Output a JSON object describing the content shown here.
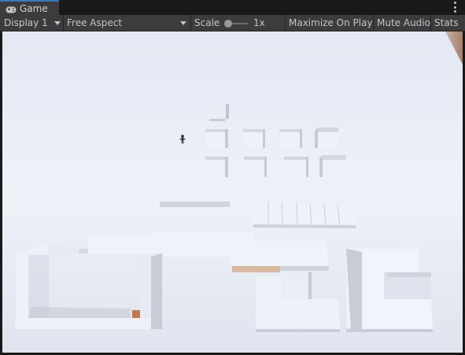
{
  "tab": {
    "title": "Game",
    "icon": "gamepad-icon"
  },
  "toolbar": {
    "display": "Display 1",
    "aspect": "Free Aspect",
    "scale_label": "Scale",
    "scale_value": "1x",
    "maximize": "Maximize On Play",
    "mute": "Mute Audio",
    "stats": "Stats"
  },
  "menu": {
    "icon": "kebab-menu-icon"
  }
}
